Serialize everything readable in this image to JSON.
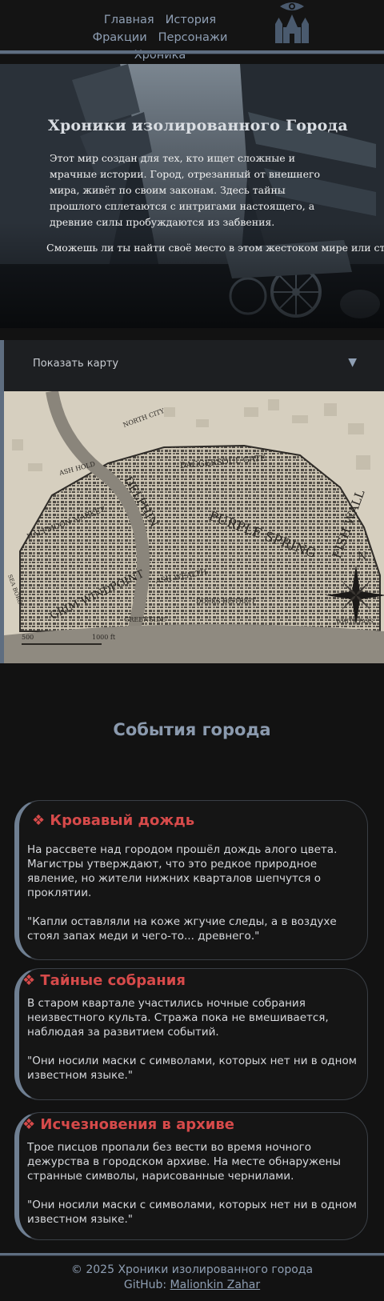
{
  "nav": {
    "items": [
      "Главная",
      "История",
      "Фракции",
      "Персонажи",
      "Хроника"
    ]
  },
  "hero": {
    "title": "Хроники изолированного Города",
    "text": "Этот мир создан для тех, кто ищет сложные и мрачные истории. Город, отрезанный от внешнего мира, живёт по своим законам. Здесь тайны прошлого сплетаются с интригами настоящего, а древние силы пробуждаются из забвения.",
    "question": "Сможешь ли ты найти своё место в этом жестоком мире или станешь лишь тенью в истории?.."
  },
  "map_toggle": {
    "label": "Показать карту",
    "arrow": "▼"
  },
  "map": {
    "labels": [
      "NORTH CITY",
      "ASH HOLD",
      "DAGGERSOUL GATE",
      "DELPHIN",
      "PURPLE SPRING",
      "FISH WALL",
      "HALFMOON MARKET",
      "GRIM WINDPOINT",
      "ASH WEALTH",
      "GREENSIDE",
      "DOCKS DISTRICT",
      "SEA BORO",
      "WHITE PASS",
      "N",
      "500",
      "1000 ft"
    ]
  },
  "events": {
    "title": "События города",
    "cards": [
      {
        "title": "❖ Кровавый дождь",
        "text": "На рассвете над городом прошёл дождь алого цвета. Магистры утверждают, что это редкое природное явление, но жители нижних кварталов шепчутся о проклятии.",
        "quote": "\"Капли оставляли на коже жгучие следы, а в воздухе стоял запах меди и чего-то... древнего.\""
      },
      {
        "title": "❖ Тайные собрания",
        "text": "В старом квартале участились ночные собрания неизвестного культа. Стража пока не вмешивается, наблюдая за развитием событий.",
        "quote": "\"Они носили маски с символами, которых нет ни в одном известном языке.\""
      },
      {
        "title": "❖ Исчезновения в архиве",
        "text": "Трое писцов пропали без вести во время ночного дежурства в городском архиве. На месте обнаружены странные символы, нарисованные чернилами.",
        "quote": "\"Они носили маски с символами, которых нет ни в одном известном языке.\""
      }
    ]
  },
  "footer": {
    "copyright": "© 2025 Хроники изолированного города",
    "github_label": "GitHub:",
    "github_link": "Malionkin Zahar"
  },
  "colors": {
    "accent": "#5e6d80",
    "event_title": "#d64a4a",
    "nav": "#8f9fb4",
    "background": "#121212"
  }
}
